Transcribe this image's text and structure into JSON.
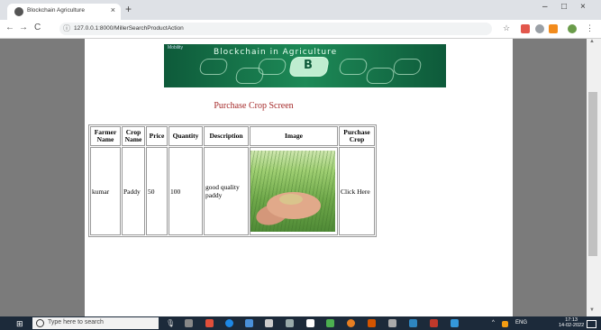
{
  "browser": {
    "tab_title": "Blockchain Agriculture",
    "tab_close": "×",
    "new_tab": "+",
    "url": "127.0.0.1:8000/MillerSearchProductAction",
    "back": "←",
    "forward": "→",
    "reload": "C",
    "info": "ⓘ",
    "star": "☆",
    "menu": "⋮",
    "win_min": "–",
    "win_max": "□",
    "win_close": "×",
    "scroll_up": "▲",
    "scroll_down": "▼"
  },
  "banner": {
    "title": "Blockchain in Agriculture",
    "small_text": "Mobility",
    "center_icon": "B"
  },
  "page": {
    "heading": "Purchase Crop Screen"
  },
  "table": {
    "headers": [
      "Farmer Name",
      "Crop Name",
      "Price",
      "Quantity",
      "Description",
      "Image",
      "Purchase Crop"
    ],
    "rows": [
      {
        "farmer": "kumar",
        "crop": "Paddy",
        "price": "50",
        "quantity": "100",
        "description": "good quality paddy",
        "action": "Click Here"
      }
    ]
  },
  "taskbar": {
    "start": "⊞",
    "search_placeholder": "Type here to search",
    "mic": "🎙",
    "clock_time": "17:13",
    "clock_date": "14-02-2022",
    "tray_lang": "ENG",
    "tray_up": "^"
  },
  "colors": {
    "heading": "#a52a2a",
    "banner": "#1d8a57",
    "side_gray": "#7b7b7b",
    "taskbar": "#1c2a3a"
  }
}
